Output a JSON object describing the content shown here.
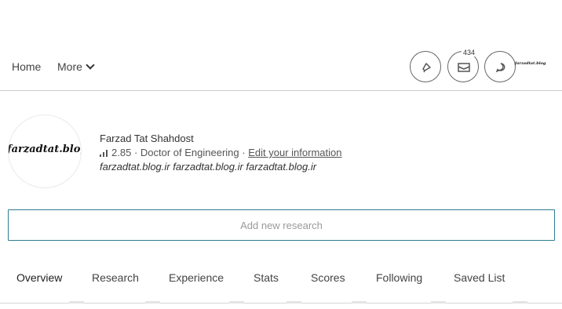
{
  "nav": {
    "home": "Home",
    "more": "More",
    "message_count": "434",
    "avatar_text": "farzadtat.blog"
  },
  "profile": {
    "avatar_text": "farzadtat.blog.ir",
    "name": "Farzad Tat Shahdost",
    "score": "2.85",
    "separator": "·",
    "degree": "Doctor of Engineering",
    "edit_link": "Edit your information",
    "tagline": "farzadtat.blog.ir farzadtat.blog.ir farzadtat.blog.ir"
  },
  "research": {
    "placeholder": "Add new research"
  },
  "tabs": [
    "Overview",
    "Research",
    "Experience",
    "Stats",
    "Scores",
    "Following",
    "Saved List"
  ],
  "colors": {
    "accent_border": "#2e7d92",
    "divider": "#d0d0d0"
  }
}
